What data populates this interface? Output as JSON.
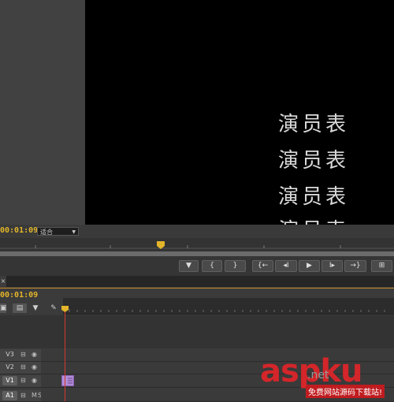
{
  "program_monitor": {
    "credits_lines": [
      "演员表",
      "演员表",
      "演员表",
      "演员表"
    ],
    "timecode": "00:01:09",
    "fit_select": {
      "value": "适合"
    }
  },
  "transport": {
    "buttons": [
      {
        "name": "add-marker-button",
        "glyph": "▼"
      },
      {
        "name": "mark-in-button",
        "glyph": "{"
      },
      {
        "name": "mark-out-button",
        "glyph": "}"
      },
      {
        "name": "go-to-in-button",
        "glyph": "{←"
      },
      {
        "name": "step-back-button",
        "glyph": "◂I"
      },
      {
        "name": "play-button",
        "glyph": "▶"
      },
      {
        "name": "step-forward-button",
        "glyph": "I▸"
      },
      {
        "name": "go-to-out-button",
        "glyph": "→}"
      },
      {
        "name": "button-editor-button",
        "glyph": "⊞"
      }
    ]
  },
  "timeline": {
    "tab_close": "×",
    "timecode": "00:01:09",
    "tracks": [
      {
        "name": "V3",
        "active": false,
        "icons": [
          "⊟",
          "◉"
        ]
      },
      {
        "name": "V2",
        "active": false,
        "icons": [
          "⊟",
          "◉"
        ]
      },
      {
        "name": "V1",
        "active": true,
        "icons": [
          "⊟",
          "◉"
        ]
      },
      {
        "name": "A1",
        "active": true,
        "icons": [
          "⊟",
          "M",
          "S"
        ]
      }
    ]
  },
  "watermark": {
    "logo": "aspku",
    "sub": ".net",
    "tagline": "免费网站源码下载站!"
  },
  "colors": {
    "timecode": "#e3b52a",
    "playhead": "#d23a2a",
    "clip": "#b28bd6",
    "watermark": "#d4262a"
  }
}
